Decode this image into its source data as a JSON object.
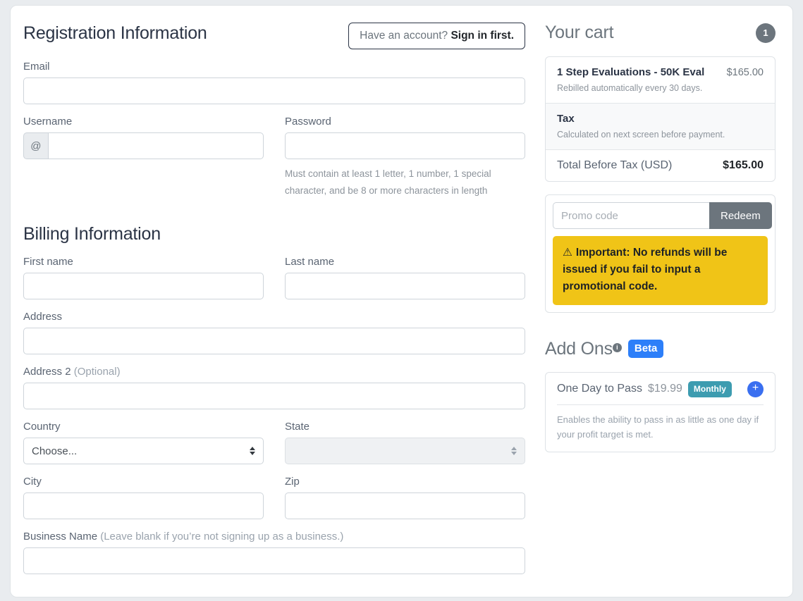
{
  "registration": {
    "title": "Registration Information",
    "signin": {
      "prefix": "Have an account? ",
      "bold": "Sign in first."
    },
    "email_label": "Email",
    "email_value": "",
    "username_label": "Username",
    "username_prefix": "@",
    "username_value": "",
    "password_label": "Password",
    "password_value": "",
    "password_help": "Must contain at least 1 letter, 1 number, 1 special character, and be 8 or more characters in length"
  },
  "billing": {
    "title": "Billing Information",
    "first_name_label": "First name",
    "first_name_value": "",
    "last_name_label": "Last name",
    "last_name_value": "",
    "address_label": "Address",
    "address_value": "",
    "address2_label": "Address 2 ",
    "address2_optional": "(Optional)",
    "address2_value": "",
    "country_label": "Country",
    "country_selected": "Choose...",
    "state_label": "State",
    "state_selected": "",
    "city_label": "City",
    "city_value": "",
    "zip_label": "Zip",
    "zip_value": "",
    "business_label": "Business Name ",
    "business_hint": "(Leave blank if you’re not signing up as a business.)",
    "business_value": ""
  },
  "cart": {
    "title": "Your cart",
    "badge_count": "1",
    "item_name": "1 Step Evaluations - 50K Eval",
    "item_sub": "Rebilled automatically every 30 days.",
    "item_price": "$165.00",
    "tax_label": "Tax",
    "tax_sub": "Calculated on next screen before payment.",
    "total_label": "Total Before Tax (USD)",
    "total_value": "$165.00"
  },
  "promo": {
    "placeholder": "Promo code",
    "value": "",
    "redeem_label": "Redeem",
    "warning_icon": "⚠",
    "warning_text": "Important: No refunds will be issued if you fail to input a promotional code."
  },
  "addons": {
    "title": "Add Ons",
    "info_icon": "i",
    "beta_label": "Beta",
    "item_name": "One Day to Pass",
    "item_price": "$19.99",
    "item_badge": "Monthly",
    "add_label": "+",
    "item_desc": "Enables the ability to pass in as little as one day if your profit target is met."
  },
  "colors": {
    "warning_bg": "#f0c417",
    "beta_bg": "#2d7ff9",
    "monthly_bg": "#3d9cb0",
    "plus_bg": "#3a6ff0",
    "redeem_bg": "#6c757d"
  }
}
